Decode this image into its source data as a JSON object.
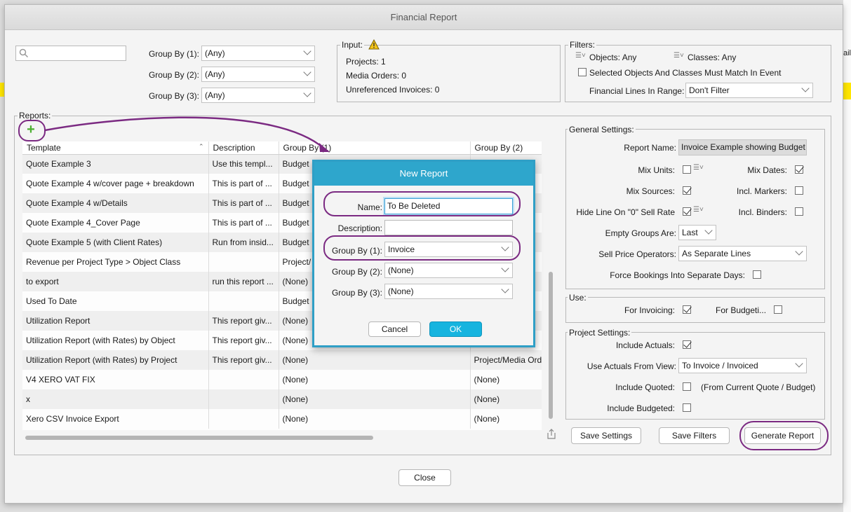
{
  "window": {
    "title": "Financial Report",
    "edge_text": "ail"
  },
  "search": {
    "value": "",
    "placeholder": ""
  },
  "group_by": [
    {
      "label": "Group By (1):",
      "value": "(Any)"
    },
    {
      "label": "Group By (2):",
      "value": "(Any)"
    },
    {
      "label": "Group By (3):",
      "value": "(Any)"
    }
  ],
  "input_box": {
    "title": "Input:",
    "projects": "Projects: 1",
    "media_orders": "Media Orders: 0",
    "unreferenced": "Unreferenced Invoices: 0"
  },
  "filters": {
    "title": "Filters:",
    "objects": "Objects: Any",
    "classes": "Classes: Any",
    "must_match": "Selected Objects And Classes Must Match In Event",
    "lines_label": "Financial Lines In Range:",
    "lines_value": "Don't Filter"
  },
  "reports": {
    "title": "Reports:",
    "columns": [
      "Template",
      "Description",
      "Group By (1)",
      "Group By (2)"
    ],
    "rows": [
      [
        "Quote Example 3",
        "Use this templ...",
        "Budget",
        ""
      ],
      [
        "Quote Example 4 w/cover page + breakdown",
        "This is part of ...",
        "Budget",
        ""
      ],
      [
        "Quote Example 4 w/Details",
        "This is part of ...",
        "Budget",
        ""
      ],
      [
        "Quote Example 4_Cover Page",
        "This is part of ...",
        "Budget",
        ""
      ],
      [
        "Quote Example 5 (with Client Rates)",
        "Run from insid...",
        "Budget",
        ""
      ],
      [
        "Revenue per Project Type > Object Class",
        "",
        "Project/",
        ""
      ],
      [
        "to export",
        "run this report ...",
        "(None)",
        ""
      ],
      [
        "Used To Date",
        "",
        "Budget",
        ""
      ],
      [
        "Utilization Report",
        "This report giv...",
        "(None)",
        ""
      ],
      [
        "Utilization Report (with Rates) by Object",
        "This report giv...",
        "(None)",
        ""
      ],
      [
        "Utilization Report (with Rates) by Project",
        "This report giv...",
        "(None)",
        "Project/Media Ord"
      ],
      [
        "V4 XERO VAT FIX",
        "",
        "(None)",
        "(None)"
      ],
      [
        "x",
        "",
        "(None)",
        "(None)"
      ],
      [
        "Xero CSV Invoice Export",
        "",
        "(None)",
        "(None)"
      ]
    ]
  },
  "general": {
    "title": "General Settings:",
    "report_name_label": "Report Name:",
    "report_name_value": "Invoice Example showing Budget",
    "mix_units": "Mix Units:",
    "mix_dates": "Mix Dates:",
    "mix_sources": "Mix Sources:",
    "incl_markers": "Incl. Markers:",
    "hide_line": "Hide Line On \"0\" Sell Rate",
    "incl_binders": "Incl. Binders:",
    "empty_groups_label": "Empty Groups Are:",
    "empty_groups_value": "Last",
    "sell_price_label": "Sell Price Operators:",
    "sell_price_value": "As Separate Lines",
    "force_bookings": "Force Bookings Into Separate Days:"
  },
  "use": {
    "title": "Use:",
    "for_invoicing": "For Invoicing:",
    "for_budgeting": "For Budgeti..."
  },
  "project": {
    "title": "Project Settings:",
    "include_actuals": "Include Actuals:",
    "actuals_view_label": "Use Actuals From View:",
    "actuals_view_value": "To Invoice / Invoiced",
    "include_quoted": "Include Quoted:",
    "quoted_note": "(From Current Quote / Budget)",
    "include_budgeted": "Include Budgeted:"
  },
  "buttons": {
    "save_settings": "Save Settings",
    "save_filters": "Save Filters",
    "generate": "Generate Report",
    "close": "Close"
  },
  "dialog": {
    "title": "New Report",
    "name_label": "Name:",
    "name_value": "To Be Deleted",
    "description_label": "Description:",
    "description_value": "",
    "gb1_label": "Group By (1):",
    "gb1_value": "Invoice",
    "gb2_label": "Group By (2):",
    "gb2_value": "(None)",
    "gb3_label": "Group By (3):",
    "gb3_value": "(None)",
    "cancel": "Cancel",
    "ok": "OK"
  },
  "colors": {
    "accent": "#2ea6cc",
    "highlight": "#7b2a82",
    "add": "#4caf30",
    "warning": "#f5c518"
  }
}
